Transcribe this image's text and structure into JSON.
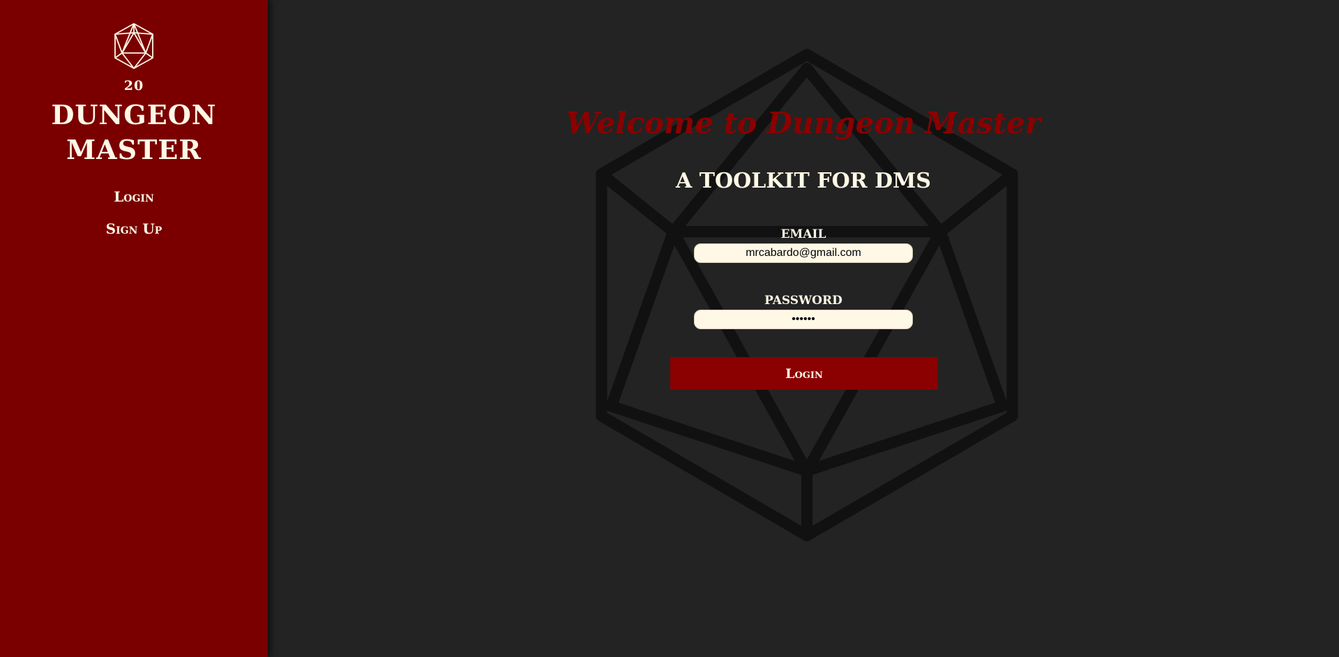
{
  "sidebar": {
    "logo_icon": "d20-icon",
    "logo_number": "20",
    "title": "DUNGEON MASTER",
    "nav": [
      {
        "label": "Login"
      },
      {
        "label": "Sign Up"
      }
    ]
  },
  "main": {
    "background_icon": "d20-icon",
    "welcome": "Welcome to Dungeon Master",
    "subtitle": "A TOOLKIT FOR DMS",
    "form": {
      "email_label": "EMAIL",
      "email_value": "mrcabardo@gmail.com",
      "password_label": "PASSWORD",
      "password_value": "••••••",
      "submit_label": "Login"
    }
  },
  "colors": {
    "sidebar_bg": "#7a0000",
    "main_bg": "#232323",
    "accent_red": "#8b0000",
    "cream": "#fff8e6"
  }
}
